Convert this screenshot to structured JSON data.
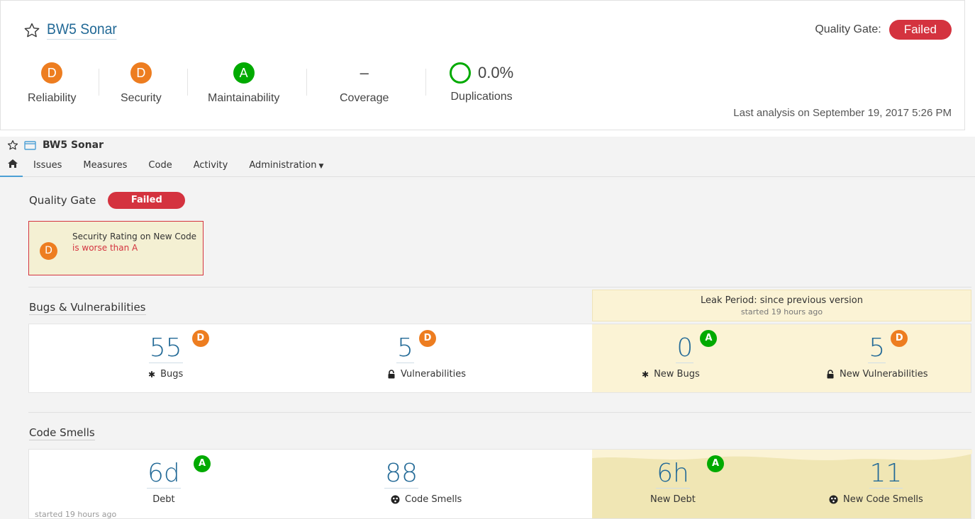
{
  "top": {
    "project_name": "BW5 Sonar",
    "quality_gate_label": "Quality Gate:",
    "quality_gate_status": "Failed",
    "metrics": [
      {
        "rating": "D",
        "label": "Reliability",
        "color": "#ed7d20"
      },
      {
        "rating": "D",
        "label": "Security",
        "color": "#ed7d20"
      },
      {
        "rating": "A",
        "label": "Maintainability",
        "color": "#00aa00"
      }
    ],
    "coverage": {
      "value": "–",
      "label": "Coverage"
    },
    "duplications": {
      "value": "0.0%",
      "label": "Duplications"
    },
    "last_analysis": "Last analysis on September 19, 2017 5:26 PM"
  },
  "header": {
    "project_name": "BW5 Sonar"
  },
  "tabs": [
    "Issues",
    "Measures",
    "Code",
    "Activity",
    "Administration"
  ],
  "quality_gate": {
    "title": "Quality Gate",
    "status": "Failed",
    "condition": {
      "rating": "D",
      "metric": "Security Rating on New Code",
      "result": "is worse than A"
    }
  },
  "leak_period": {
    "title": "Leak Period: since previous version",
    "started": "started 19 hours ago"
  },
  "bugs_vulns": {
    "title": "Bugs & Vulnerabilities",
    "bugs": {
      "value": "55",
      "rating": "D",
      "label": "Bugs"
    },
    "vulnerabilities": {
      "value": "5",
      "rating": "D",
      "label": "Vulnerabilities"
    },
    "new_bugs": {
      "value": "0",
      "rating": "A",
      "label": "New Bugs"
    },
    "new_vulnerabilities": {
      "value": "5",
      "rating": "D",
      "label": "New Vulnerabilities"
    }
  },
  "code_smells": {
    "title": "Code Smells",
    "debt": {
      "value": "6d",
      "rating": "A",
      "label": "Debt"
    },
    "smells": {
      "value": "88",
      "label": "Code Smells"
    },
    "new_debt": {
      "value": "6h",
      "rating": "A",
      "label": "New Debt"
    },
    "new_smells": {
      "value": "11",
      "label": "New Code Smells"
    },
    "started_note": "started 19 hours ago"
  },
  "colors": {
    "failed": "#d4333f",
    "rating_d": "#ed7d20",
    "rating_a": "#00aa00",
    "link_blue": "#236a97",
    "leak_bg": "#fbf3d5"
  },
  "icons": {
    "star": "star-outline-icon",
    "folder": "project-folder-icon",
    "home": "home-icon",
    "bug": "bug-icon",
    "lock": "lock-icon",
    "smell": "code-smell-icon"
  }
}
